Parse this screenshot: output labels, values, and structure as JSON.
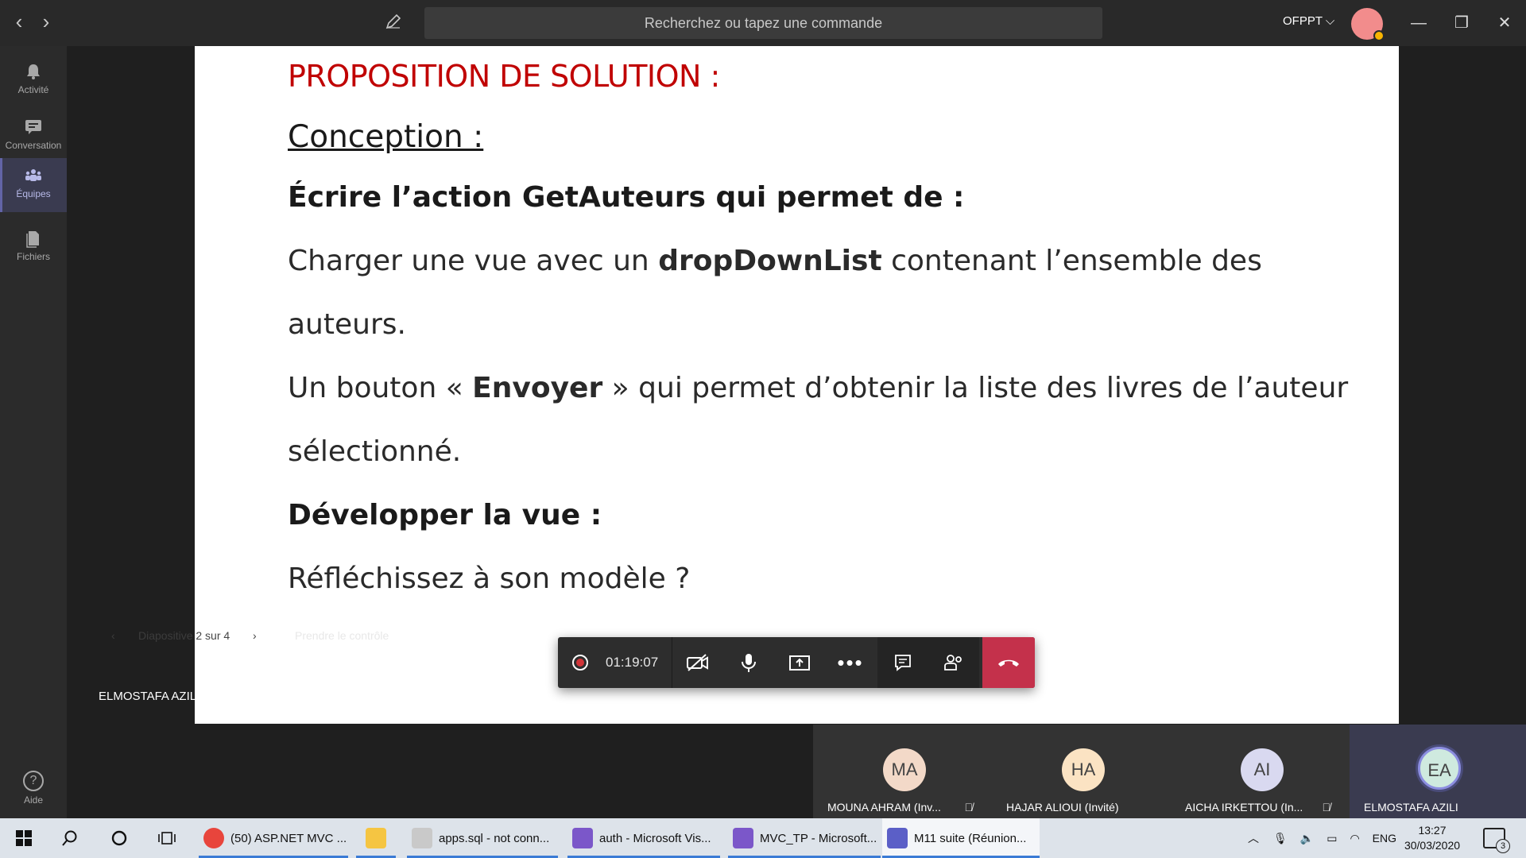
{
  "titlebar": {
    "search_placeholder": "Recherchez ou tapez une commande",
    "org": "OFPPT",
    "org_chevron": "⌵"
  },
  "rail": {
    "items": [
      {
        "label": "Activité",
        "icon": "bell-icon"
      },
      {
        "label": "Conversation",
        "icon": "chat-icon"
      },
      {
        "label": "Équipes",
        "icon": "teams-icon"
      },
      {
        "label": "Fichiers",
        "icon": "files-icon"
      }
    ],
    "help": "Aide"
  },
  "slide": {
    "title": "PROPOSITION DE SOLUTION :",
    "subtitle": "Conception :",
    "l1": "Écrire l’action GetAuteurs qui permet de :",
    "l2a": "Charger une vue avec un ",
    "l2b": "dropDownList",
    "l2c": " contenant l’ensemble des",
    "l3": "auteurs.",
    "l4a": "Un bouton « ",
    "l4b": "Envoyer",
    "l4c": " » qui permet d’obtenir la liste des livres de l’auteur",
    "l5": "sélectionné.",
    "l6": "Développer la vue :",
    "l7": "Réfléchissez à son modèle ?"
  },
  "stage": {
    "presenter": "ELMOSTAFA AZILI",
    "ghost_slide_counter": "Diapositive 2 sur 4",
    "ghost_take_control": "Prendre le contrôle"
  },
  "call": {
    "timer": "01:19:07"
  },
  "participants": [
    {
      "initials": "MA",
      "name": "MOUNA AHRAM (Inv...",
      "color": "#f3d9c8",
      "muted": true
    },
    {
      "initials": "HA",
      "name": "HAJAR ALIOUI (Invité)",
      "color": "#fbe3c3",
      "muted": false
    },
    {
      "initials": "AI",
      "name": "AICHA IRKETTOU (In...",
      "color": "#d9d9f0",
      "muted": true
    },
    {
      "initials": "EA",
      "name": "ELMOSTAFA AZILI",
      "color": "#cfeadf",
      "muted": false
    }
  ],
  "taskbar": {
    "apps": [
      {
        "label": "(50) ASP.NET MVC ...",
        "icon": "chrome-icon",
        "color": "#e8453c"
      },
      {
        "label": "",
        "icon": "folder-icon",
        "color": "#f5c542"
      },
      {
        "label": "apps.sql - not conn...",
        "icon": "sql-icon",
        "color": "#c9c9c9"
      },
      {
        "label": "auth - Microsoft Vis...",
        "icon": "visual-studio-icon",
        "color": "#7b57c9"
      },
      {
        "label": "MVC_TP - Microsoft...",
        "icon": "visual-studio-icon",
        "color": "#7b57c9"
      },
      {
        "label": "M11 suite (Réunion...",
        "icon": "teams-icon",
        "color": "#5b5fc7"
      }
    ],
    "lang": "ENG",
    "time": "13:27",
    "date": "30/03/2020",
    "notif_count": "3"
  }
}
